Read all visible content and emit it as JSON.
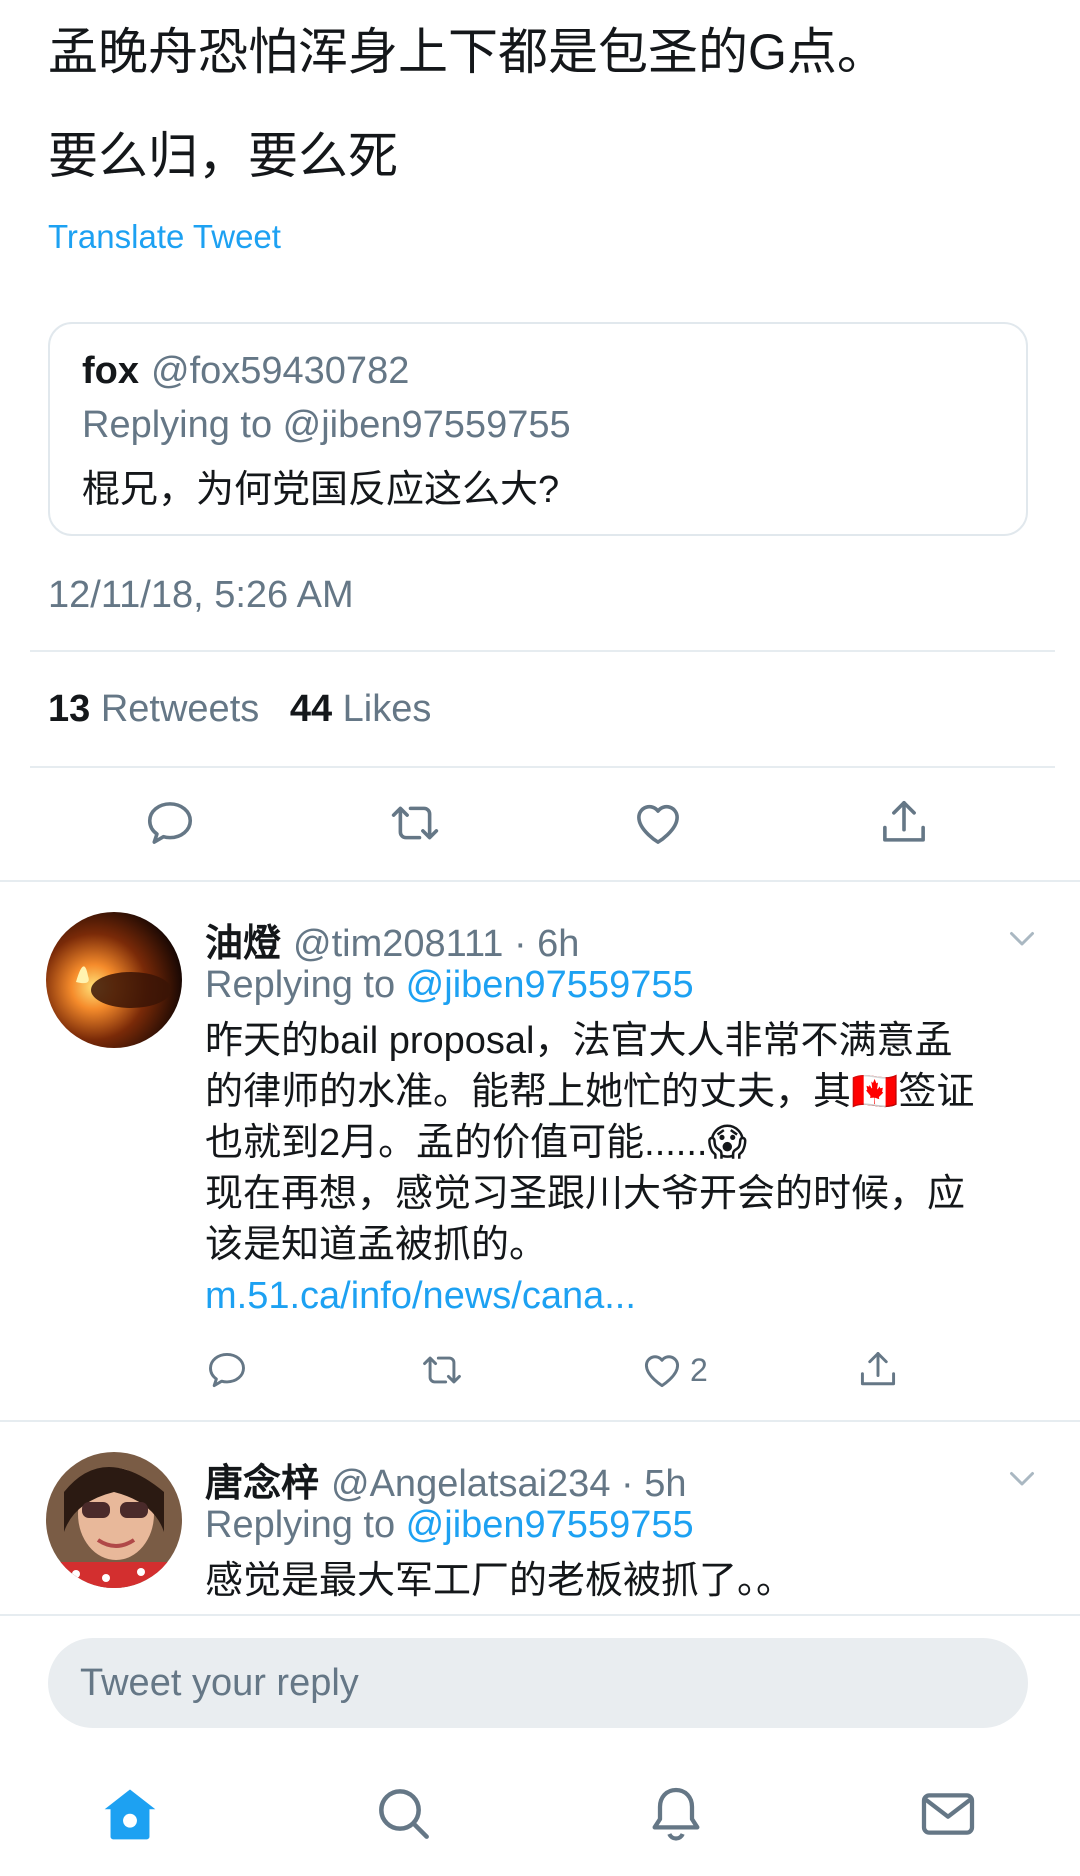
{
  "tweet": {
    "line1": "孟晚舟恐怕浑身上下都是包圣的G点。",
    "line2": "要么归，要么死",
    "translate": "Translate Tweet"
  },
  "quoted": {
    "name": "fox",
    "handle": "@fox59430782",
    "replying_to": "Replying to @jiben97559755",
    "body": "棍兄，为何党国反应这么大?"
  },
  "timestamp": "12/11/18, 5:26 AM",
  "stats": {
    "retweets_count": "13",
    "retweets_label": "Retweets",
    "likes_count": "44",
    "likes_label": "Likes"
  },
  "replies": [
    {
      "name": "油燈",
      "handle": "@tim208111 · 6h",
      "replying_prefix": "Replying to ",
      "replying_mention": "@jiben97559755",
      "body_lines": [
        "昨天的bail proposal，法官大人非常不满意孟",
        "的律师的水准。能帮上她忙的丈夫，其🇨🇦签证",
        "也就到2月。孟的价值可能......😱",
        "现在再想，感觉习圣跟川大爷开会的时候，应",
        "该是知道孟被抓的。"
      ],
      "link": "m.51.ca/info/news/cana...",
      "like_count": "2"
    },
    {
      "name": "唐念梓",
      "handle": "@Angelatsai234 · 5h",
      "replying_prefix": "Replying to ",
      "replying_mention": "@jiben97559755",
      "body_lines": [
        "感觉是最大军工厂的老板被抓了。。"
      ]
    }
  ],
  "compose": {
    "placeholder": "Tweet your reply"
  },
  "colors": {
    "accent": "#1da1f2",
    "muted": "#657786",
    "text": "#14171a"
  },
  "icons": [
    "reply-icon",
    "retweet-icon",
    "like-icon",
    "share-icon",
    "chevron-down-icon",
    "home-icon",
    "search-icon",
    "notifications-icon",
    "messages-icon"
  ]
}
